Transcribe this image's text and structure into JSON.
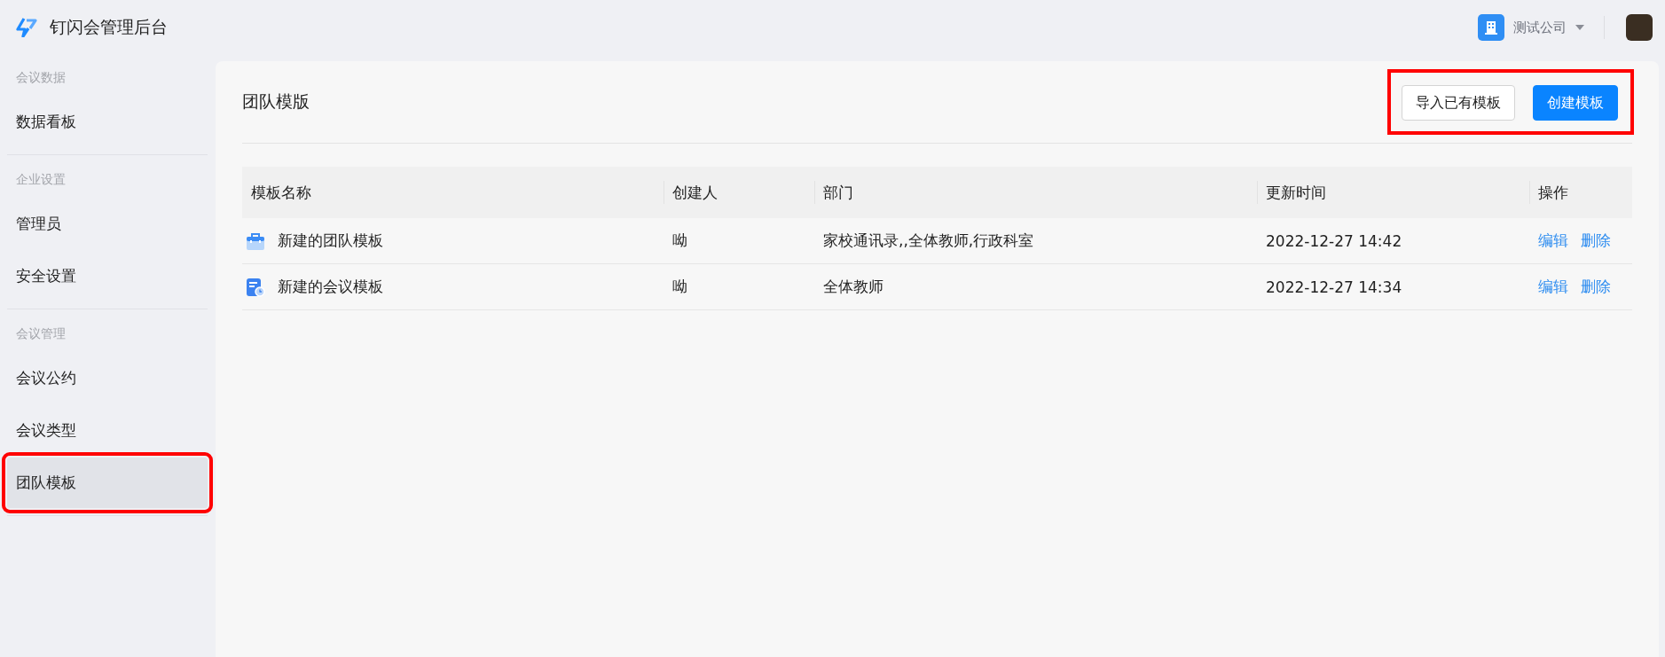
{
  "header": {
    "title": "钉闪会管理后台",
    "company": "测试公司"
  },
  "sidebar": {
    "groups": [
      {
        "label": "会议数据",
        "items": [
          {
            "label": "数据看板",
            "selected": false,
            "highlighted": false
          }
        ]
      },
      {
        "label": "企业设置",
        "items": [
          {
            "label": "管理员",
            "selected": false,
            "highlighted": false
          },
          {
            "label": "安全设置",
            "selected": false,
            "highlighted": false
          }
        ]
      },
      {
        "label": "会议管理",
        "items": [
          {
            "label": "会议公约",
            "selected": false,
            "highlighted": false
          },
          {
            "label": "会议类型",
            "selected": false,
            "highlighted": false
          },
          {
            "label": "团队模板",
            "selected": true,
            "highlighted": true
          }
        ]
      }
    ]
  },
  "panel": {
    "title": "团队模版",
    "actions_highlighted": true,
    "buttons": [
      {
        "label": "导入已有模板",
        "kind": "secondary"
      },
      {
        "label": "创建模板",
        "kind": "primary"
      }
    ]
  },
  "table": {
    "columns": [
      "模板名称",
      "创建人",
      "部门",
      "更新时间",
      "操作"
    ],
    "rows": [
      {
        "kind": "team",
        "name": "新建的团队模板",
        "creator": "呦",
        "department": "家校通讯录,,全体教师,行政科室",
        "updated": "2022-12-27 14:42",
        "actions": [
          "编辑",
          "删除"
        ]
      },
      {
        "kind": "meeting",
        "name": "新建的会议模板",
        "creator": "呦",
        "department": "全体教师",
        "updated": "2022-12-27 14:34",
        "actions": [
          "编辑",
          "删除"
        ]
      }
    ]
  }
}
